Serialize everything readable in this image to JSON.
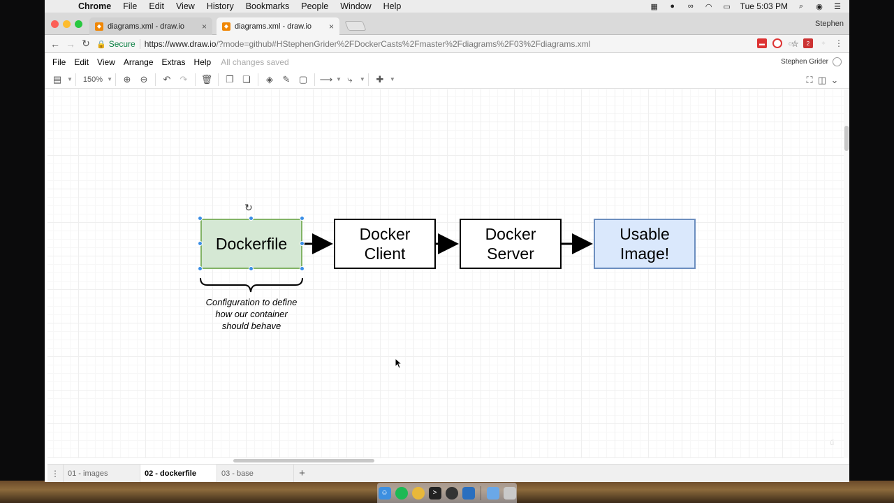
{
  "menubar": {
    "app": "Chrome",
    "items": [
      "File",
      "Edit",
      "View",
      "History",
      "Bookmarks",
      "People",
      "Window",
      "Help"
    ],
    "clock": "Tue 5:03 PM"
  },
  "tabs": [
    {
      "title": "diagrams.xml - draw.io",
      "close": "×"
    },
    {
      "title": "diagrams.xml - draw.io",
      "close": "×"
    }
  ],
  "profile": "Stephen",
  "address": {
    "secure": "Secure",
    "url_main": "https://www.draw.io",
    "url_rest": "/?mode=github#HStephenGrider%2FDockerCasts%2Fmaster%2Fdiagrams%2F03%2Fdiagrams.xml"
  },
  "drawio": {
    "menu": [
      "File",
      "Edit",
      "View",
      "Arrange",
      "Extras",
      "Help"
    ],
    "status": "All changes saved",
    "user": "Stephen Grider",
    "zoom": "150%"
  },
  "diagram": {
    "nodes": {
      "dockerfile": "Dockerfile",
      "client": "Docker\nClient",
      "server": "Docker\nServer",
      "image": "Usable\nImage!"
    },
    "caption": "Configuration to define\nhow our container\nshould behave",
    "colors": {
      "dockerfile_fill": "#d5e8d4",
      "dockerfile_stroke": "#82b366",
      "image_fill": "#dae8fc",
      "image_stroke": "#6c8ebf",
      "selection": "#3a8ee6"
    }
  },
  "pages": [
    "01 - images",
    "02 - dockerfile",
    "03 - base"
  ],
  "add_page": "+"
}
